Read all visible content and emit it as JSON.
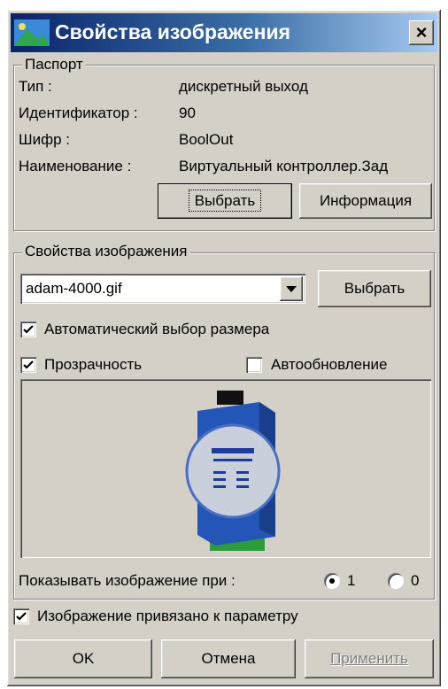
{
  "window": {
    "title": "Свойства изображения",
    "close_label": "×"
  },
  "passport": {
    "legend": "Паспорт",
    "rows": [
      {
        "label": "Тип :",
        "value": "дискретный выход"
      },
      {
        "label": "Идентификатор :",
        "value": "90"
      },
      {
        "label": "Шифр :",
        "value": "BoolOut"
      },
      {
        "label": "Наименование :",
        "value": "Виртуальный контроллер.Зад"
      }
    ],
    "select_button": "Выбрать",
    "info_button": "Информация"
  },
  "image_props": {
    "legend": "Свойства изображения",
    "file_value": "adam-4000.gif",
    "select_button": "Выбрать",
    "auto_size": {
      "label": "Автоматический выбор размера",
      "checked": true
    },
    "transparency": {
      "label": "Прозрачность",
      "checked": true
    },
    "auto_update": {
      "label": "Автообновление",
      "checked": false
    },
    "show_label": "Показывать изображение при :",
    "radio_1": "1",
    "radio_0": "0"
  },
  "bound_param": {
    "label": "Изображение привязано к параметру",
    "checked": true
  },
  "buttons": {
    "ok": "OK",
    "cancel": "Отмена",
    "apply": "Применить"
  }
}
